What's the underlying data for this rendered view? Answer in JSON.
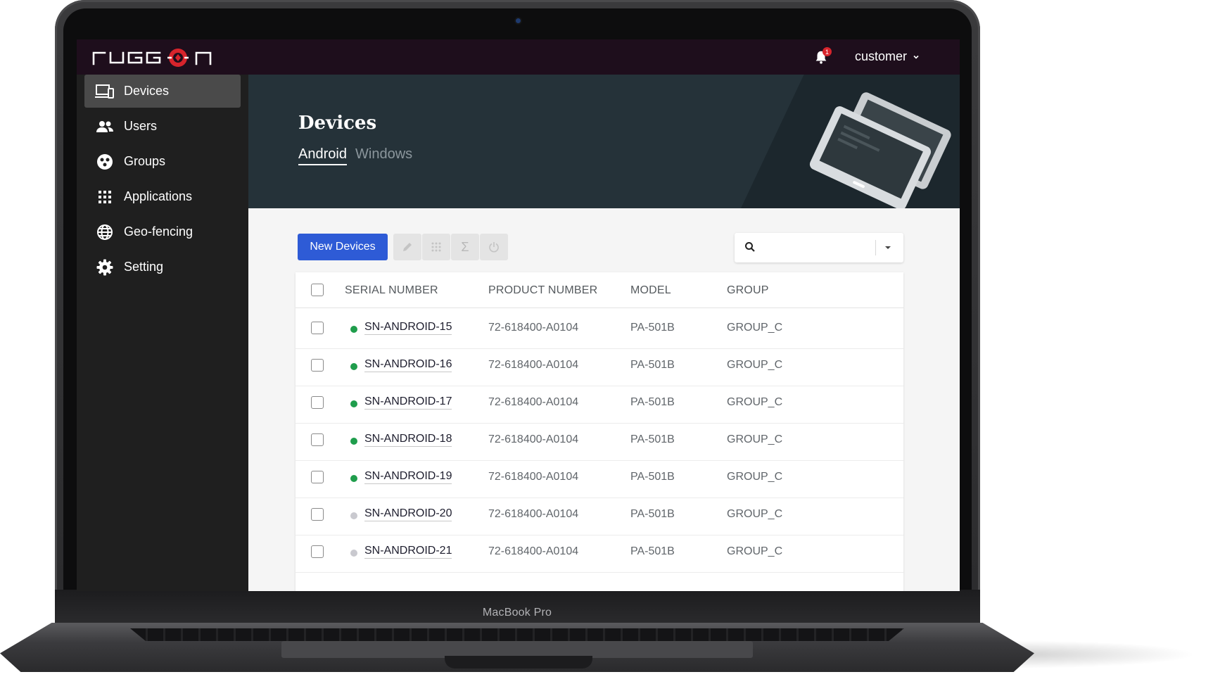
{
  "laptop": {
    "brand_label": "MacBook Pro"
  },
  "topbar": {
    "notification_count": "1",
    "user_name": "customer"
  },
  "sidebar": {
    "items": [
      {
        "label": "Devices",
        "icon": "devices-icon",
        "active": true
      },
      {
        "label": "Users",
        "icon": "users-icon",
        "active": false
      },
      {
        "label": "Groups",
        "icon": "groups-icon",
        "active": false
      },
      {
        "label": "Applications",
        "icon": "apps-grid-icon",
        "active": false
      },
      {
        "label": "Geo-fencing",
        "icon": "globe-icon",
        "active": false
      },
      {
        "label": "Setting",
        "icon": "gear-icon",
        "active": false
      }
    ]
  },
  "header": {
    "title": "Devices",
    "tabs": [
      {
        "label": "Android",
        "active": true
      },
      {
        "label": "Windows",
        "active": false
      }
    ]
  },
  "toolbar": {
    "new_button_label": "New Devices",
    "tool_icons": [
      "edit-icon",
      "grid-icon",
      "sigma-icon",
      "power-icon"
    ],
    "search_placeholder": ""
  },
  "table": {
    "columns": [
      "SERIAL NUMBER",
      "PRODUCT NUMBER",
      "MODEL",
      "GROUP"
    ],
    "rows": [
      {
        "status": "online",
        "serial": "SN-ANDROID-15",
        "product": "72-618400-A0104",
        "model": "PA-501B",
        "group": "GROUP_C"
      },
      {
        "status": "online",
        "serial": "SN-ANDROID-16",
        "product": "72-618400-A0104",
        "model": "PA-501B",
        "group": "GROUP_C"
      },
      {
        "status": "online",
        "serial": "SN-ANDROID-17",
        "product": "72-618400-A0104",
        "model": "PA-501B",
        "group": "GROUP_C"
      },
      {
        "status": "online",
        "serial": "SN-ANDROID-18",
        "product": "72-618400-A0104",
        "model": "PA-501B",
        "group": "GROUP_C"
      },
      {
        "status": "online",
        "serial": "SN-ANDROID-19",
        "product": "72-618400-A0104",
        "model": "PA-501B",
        "group": "GROUP_C"
      },
      {
        "status": "offline",
        "serial": "SN-ANDROID-20",
        "product": "72-618400-A0104",
        "model": "PA-501B",
        "group": "GROUP_C"
      },
      {
        "status": "offline",
        "serial": "SN-ANDROID-21",
        "product": "72-618400-A0104",
        "model": "PA-501B",
        "group": "GROUP_C"
      }
    ]
  },
  "colors": {
    "topbar_bg": "#1e0e1c",
    "sidebar_bg": "#1f1f1f",
    "hero_bg": "#253239",
    "primary_button": "#2e5bd6",
    "status_online": "#1f9d4c",
    "status_offline": "#c9c9cf",
    "brand_red": "#d7242c"
  }
}
